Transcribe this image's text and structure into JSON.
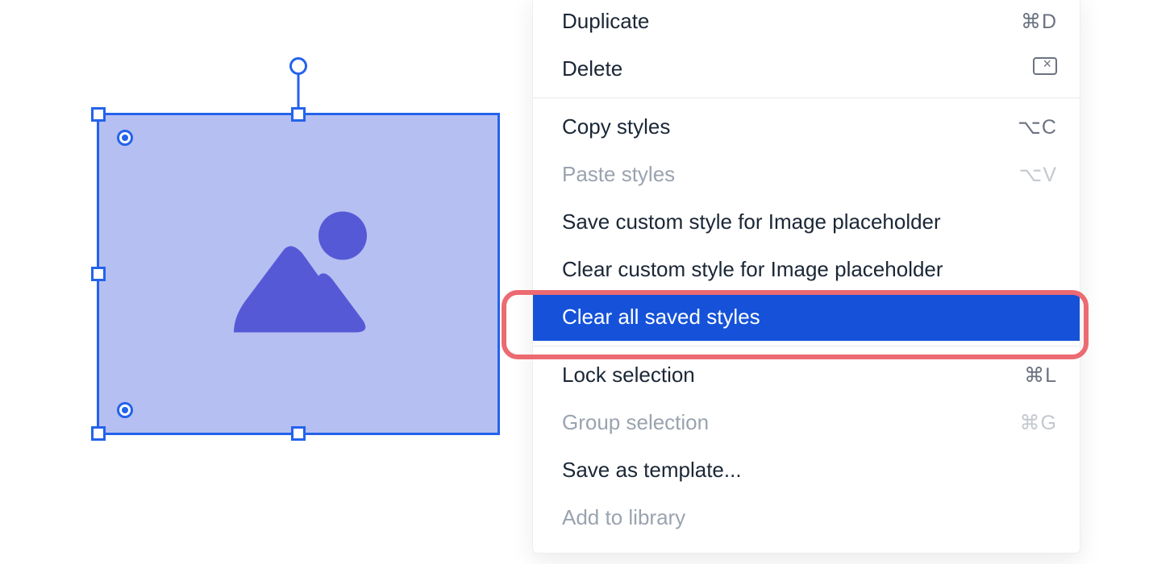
{
  "canvas": {
    "selected_element_name": "Image placeholder"
  },
  "context_menu": {
    "items": [
      {
        "label": "Duplicate",
        "shortcut": "⌘D",
        "enabled": true,
        "selected": false
      },
      {
        "label": "Delete",
        "shortcut": "",
        "icon": "delete",
        "enabled": true,
        "selected": false
      },
      {
        "divider": true
      },
      {
        "label": "Copy styles",
        "shortcut": "⌥C",
        "enabled": true,
        "selected": false
      },
      {
        "label": "Paste styles",
        "shortcut": "⌥V",
        "enabled": false,
        "selected": false
      },
      {
        "label": "Save custom style for Image placeholder",
        "shortcut": "",
        "enabled": true,
        "selected": false
      },
      {
        "label": "Clear custom style for Image placeholder",
        "shortcut": "",
        "enabled": true,
        "selected": false
      },
      {
        "label": "Clear all saved styles",
        "shortcut": "",
        "enabled": true,
        "selected": true
      },
      {
        "divider": true
      },
      {
        "label": "Lock selection",
        "shortcut": "⌘L",
        "enabled": true,
        "selected": false
      },
      {
        "label": "Group selection",
        "shortcut": "⌘G",
        "enabled": false,
        "selected": false
      },
      {
        "label": "Save as template...",
        "shortcut": "",
        "enabled": true,
        "selected": false
      },
      {
        "label": "Add to library",
        "shortcut": "",
        "enabled": false,
        "selected": false
      }
    ]
  },
  "annotation": {
    "target_item_label": "Clear all saved styles"
  }
}
